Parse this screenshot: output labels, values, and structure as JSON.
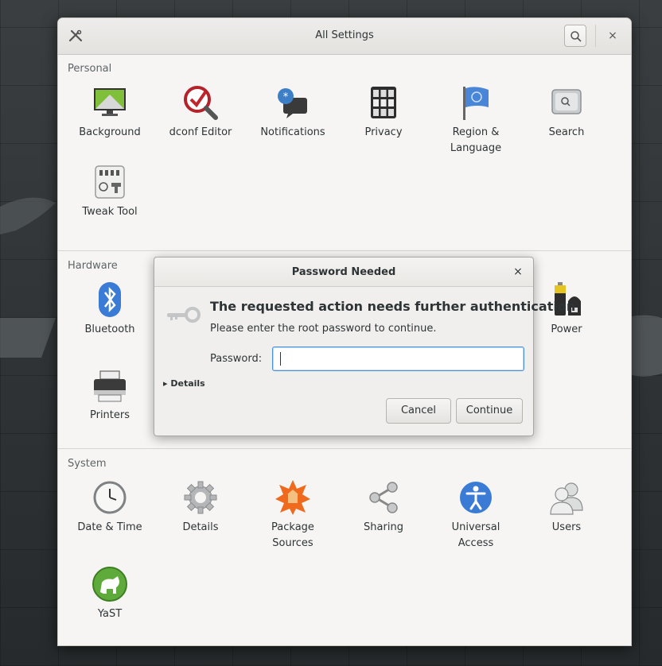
{
  "window": {
    "title": "All Settings",
    "search_icon": "search-icon",
    "close_label": "×",
    "tools_icon": "tools-icon"
  },
  "sections": {
    "personal": {
      "title": "Personal",
      "items": [
        {
          "label": "Background",
          "icon": "background-icon"
        },
        {
          "label": "dconf Editor",
          "icon": "dconf-editor-icon"
        },
        {
          "label": "Notifications",
          "icon": "notifications-icon"
        },
        {
          "label": "Privacy",
          "icon": "privacy-icon"
        },
        {
          "label": "Region &\nLanguage",
          "icon": "region-flag-icon"
        },
        {
          "label": "Search",
          "icon": "search-app-icon"
        },
        {
          "label": "Tweak Tool",
          "icon": "tweak-tool-icon"
        }
      ]
    },
    "hardware": {
      "title": "Hardware",
      "items": [
        {
          "label": "Bluetooth",
          "icon": "bluetooth-icon"
        },
        {
          "label": "Power",
          "icon": "power-icon"
        },
        {
          "label": "Printers",
          "icon": "printer-icon"
        }
      ]
    },
    "system": {
      "title": "System",
      "items": [
        {
          "label": "Date & Time",
          "icon": "clock-icon"
        },
        {
          "label": "Details",
          "icon": "gear-icon"
        },
        {
          "label": "Package\nSources",
          "icon": "package-sources-icon"
        },
        {
          "label": "Sharing",
          "icon": "share-icon"
        },
        {
          "label": "Universal\nAccess",
          "icon": "accessibility-icon"
        },
        {
          "label": "Users",
          "icon": "users-icon"
        },
        {
          "label": "YaST",
          "icon": "yast-icon"
        }
      ]
    }
  },
  "dialog": {
    "title": "Password Needed",
    "close_label": "×",
    "heading": "The requested action needs further authentication",
    "message": "Please enter the root password to continue.",
    "password_label": "Password:",
    "password_value": "",
    "details_label": "▸ Details",
    "cancel_label": "Cancel",
    "continue_label": "Continue",
    "key_icon": "key-icon"
  },
  "colors": {
    "accent": "#4a90d9",
    "window_bg": "#f6f5f4"
  }
}
